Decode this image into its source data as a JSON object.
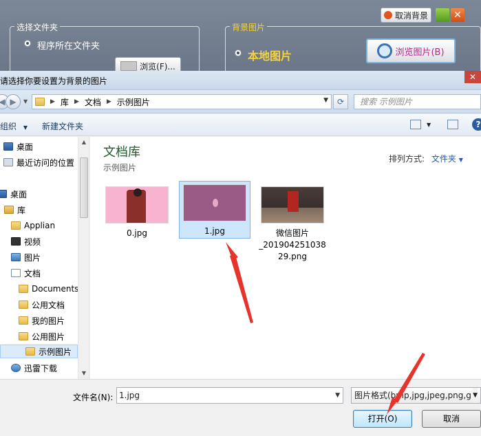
{
  "background_app": {
    "cancel_bg_label": "取消背景",
    "folder_group_title": "选择文件夹",
    "folder_option": "程序所在文件夹",
    "browse_folder_label": "浏览(F)...",
    "bg_group_title": "背景图片",
    "local_image_option": "本地图片",
    "browse_image_label": "浏览图片(B)"
  },
  "dialog": {
    "title": "请选择你要设置为背景的图片",
    "close_glyph": "✕",
    "breadcrumb": [
      "库",
      "文档",
      "示例图片"
    ],
    "search_placeholder": "搜索 示例图片",
    "toolbar": {
      "organize": "组织",
      "new_folder": "新建文件夹"
    },
    "nav_items": [
      {
        "label": "桌面",
        "icon": "desktop-icon"
      },
      {
        "label": "最近访问的位置",
        "icon": "recent-places-icon"
      },
      {
        "label": "桌面",
        "icon": "desktop-icon"
      },
      {
        "label": "库",
        "icon": "library-icon"
      },
      {
        "label": "Applian",
        "icon": "folder-icon"
      },
      {
        "label": "视频",
        "icon": "video-icon"
      },
      {
        "label": "图片",
        "icon": "pictures-icon"
      },
      {
        "label": "文档",
        "icon": "documents-icon"
      },
      {
        "label": "Documents",
        "icon": "folder-icon"
      },
      {
        "label": "公用文档",
        "icon": "folder-icon"
      },
      {
        "label": "我的图片",
        "icon": "folder-icon"
      },
      {
        "label": "公用图片",
        "icon": "folder-icon"
      },
      {
        "label": "示例图片",
        "icon": "folder-icon"
      },
      {
        "label": "迅雷下载",
        "icon": "download-icon"
      }
    ],
    "library_title": "文档库",
    "library_subtitle": "示例图片",
    "arrange_label": "排列方式:",
    "arrange_value": "文件夹",
    "files": [
      {
        "name": "0.jpg",
        "selected": false
      },
      {
        "name": "1.jpg",
        "selected": true
      },
      {
        "name": "微信图片_20190425103829.png",
        "name_line1": "微信图片",
        "name_line2": "_201904251038",
        "name_line3": "29.png",
        "selected": false
      }
    ],
    "filename_label": "文件名(N):",
    "filename_value": "1.jpg",
    "filter_value": "图片格式(bmp,jpg,jpeg,png,g",
    "open_label": "打开(O)",
    "cancel_label": "取消"
  },
  "colors": {
    "annotation_arrow": "#e8322c",
    "library_title": "#1e5a2c",
    "selection": "#cde6fb"
  }
}
